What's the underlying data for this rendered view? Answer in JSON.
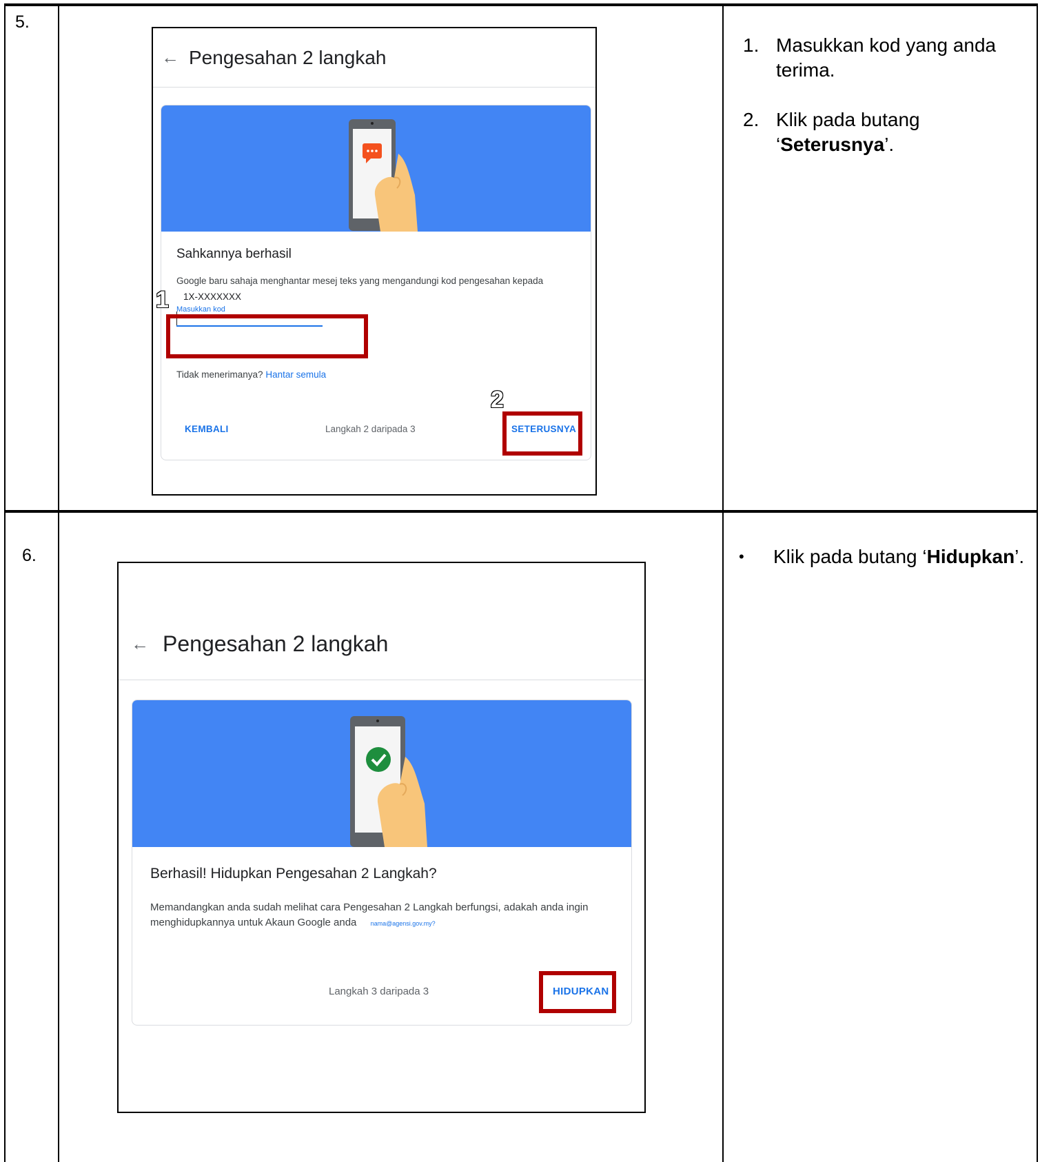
{
  "rows": [
    {
      "number": "5.",
      "screenshot": {
        "title": "Pengesahan 2 langkah",
        "card_title": "Sahkannya berhasil",
        "message": "Google baru sahaja menghantar mesej teks yang mengandungi kod pengesahan kepada",
        "phone": "1X-XXXXXXX",
        "code_label": "Masukkan kod",
        "code_value": "",
        "resend_prompt": "Tidak menerimanya?",
        "resend_link": "Hantar semula",
        "back_button": "KEMBALI",
        "step": "Langkah 2 daripada 3",
        "next_button": "SETERUSNYA",
        "callouts": [
          "1",
          "2"
        ]
      },
      "instructions": [
        {
          "marker": "1.",
          "text": "Masukkan kod yang anda terima."
        },
        {
          "marker": "2.",
          "pre": "Klik pada butang ‘",
          "bold": "Seterusnya",
          "post": "’."
        }
      ]
    },
    {
      "number": "6.",
      "screenshot": {
        "title": "Pengesahan 2 langkah",
        "card_title": "Berhasil! Hidupkan Pengesahan 2 Langkah?",
        "message": "Memandangkan anda sudah melihat cara Pengesahan 2 Langkah berfungsi, adakah anda ingin menghidupkannya untuk Akaun Google anda",
        "email": "nama@agensi.gov.my?",
        "step": "Langkah 3 daripada 3",
        "turn_on_button": "HIDUPKAN"
      },
      "instructions": [
        {
          "marker": "•",
          "pre": "Klik pada butang ‘",
          "bold": "Hidupkan",
          "post": "’."
        }
      ]
    }
  ],
  "colors": {
    "banner": "#4285f4",
    "highlight": "#b00000",
    "link": "#1a73e8",
    "chat_bubble": "#f4511e",
    "check": "#1e8e3e"
  },
  "icons": {
    "back": "back-arrow-icon",
    "phone_message": "phone-message-illustration",
    "phone_check": "phone-check-illustration"
  }
}
